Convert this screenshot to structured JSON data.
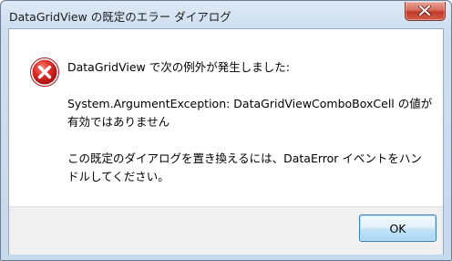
{
  "window": {
    "title": "DataGridView の既定のエラー ダイアログ"
  },
  "titlebar": {
    "close_icon": "close-icon"
  },
  "dialog": {
    "icon": "error-icon",
    "icon_color": "#d42020",
    "message": {
      "line1": "DataGridView で次の例外が発生しました:",
      "line2": "System.ArgumentException: DataGridViewComboBoxCell の値が",
      "line3": "有効ではありません",
      "line4": "この既定のダイアログを置き換えるには、DataError イベントをハン",
      "line5": "ドルしてください。"
    }
  },
  "buttons": {
    "ok_label": "OK"
  }
}
